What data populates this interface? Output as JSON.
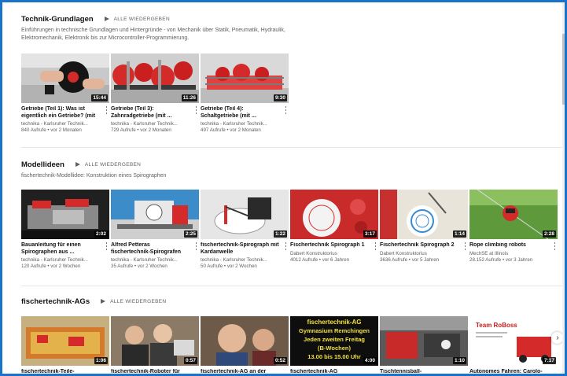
{
  "sections": [
    {
      "title": "Technik-Grundlagen",
      "play_all": "ALLE WIEDERGEBEN",
      "description": "Einführungen in technische Grundlagen und Hintergründe - von Mechanik über Statik, Pneumatik, Hydraulik, Elektromechanik, Elektronik bis zur Microcontroller-Programmierung.",
      "videos": [
        {
          "title": "Getriebe (Teil 1): Was ist eigentlich ein Getriebe? (mit ...",
          "channel": "technika - Karlsruher Technik...",
          "meta": "840 Aufrufe • vor 2 Monaten",
          "duration": "15:44"
        },
        {
          "title": "Getriebe (Teil 3): Zahnradgetriebe (mit ...",
          "channel": "technika - Karlsruher Technik...",
          "meta": "729 Aufrufe • vor 2 Monaten",
          "duration": "11:26"
        },
        {
          "title": "Getriebe (Teil 4): Schaltgetriebe (mit ...",
          "channel": "technika - Karlsruher Technik...",
          "meta": "497 Aufrufe • vor 2 Monaten",
          "duration": "9:30"
        }
      ]
    },
    {
      "title": "Modellideen",
      "play_all": "ALLE WIEDERGEBEN",
      "description": "fischertechnik-Modellidee: Konstruktion eines Spirographen",
      "videos": [
        {
          "title": "Bauanleitung für einen Spirographen aus ...",
          "channel": "technika - Karlsruher Technik...",
          "meta": "120 Aufrufe • vor 2 Wochen",
          "duration": "2:02"
        },
        {
          "title": "Alfred Petteras fischertechnik-Spirografen",
          "channel": "technika - Karlsruher Technik...",
          "meta": "35 Aufrufe • vor 2 Wochen",
          "duration": "2:25"
        },
        {
          "title": "fischertechnik-Spirograph mit Kardanwelle",
          "channel": "technika - Karlsruher Technik...",
          "meta": "50 Aufrufe • vor 2 Wochen",
          "duration": "1:22"
        },
        {
          "title": "Fischertechnik Spirograph 1",
          "channel": "Dabert Konstruktorius",
          "meta": "4012 Aufrufe • vor 6 Jahren",
          "duration": "3:17"
        },
        {
          "title": "Fischertechnik Spirograph 2",
          "channel": "Dabert Konstruktorius",
          "meta": "3636 Aufrufe • vor 5 Jahren",
          "duration": "1:14"
        },
        {
          "title": "Rope climbing robots",
          "channel": "MechSE at Illinois",
          "meta": "28.152 Aufrufe • vor 3 Jahren",
          "duration": "2:28"
        }
      ]
    },
    {
      "title": "fischertechnik-AGs",
      "play_all": "ALLE WIEDERGEBEN",
      "description": "",
      "videos": [
        {
          "title": "fischertechnik-Teile-",
          "duration": "1:06"
        },
        {
          "title": "fischertechnik-Roboter für",
          "duration": "0:57"
        },
        {
          "title": "fischertechnik-AG an der",
          "duration": "0:52"
        },
        {
          "title": "fischertechnik-AG",
          "duration": "4:00",
          "thumb_text": [
            "fischertechnik-AG",
            "Gymnasium Remchingen",
            "Jeden zweiten Freitag",
            "(B-Wochen)",
            "13.00 bis 15.00 Uhr"
          ]
        },
        {
          "title": "Tischtennisball-",
          "duration": "1:10"
        },
        {
          "title": "Autonomes Fahren: Carolo-",
          "duration": "7:17",
          "thumb_text": [
            "Team RoBoss"
          ]
        }
      ]
    }
  ],
  "next_icon": "chevron-right-icon",
  "colors": {
    "frame": "#1a73c8",
    "accent_red": "#d42a2a",
    "text": "#111111",
    "muted": "#606060"
  }
}
